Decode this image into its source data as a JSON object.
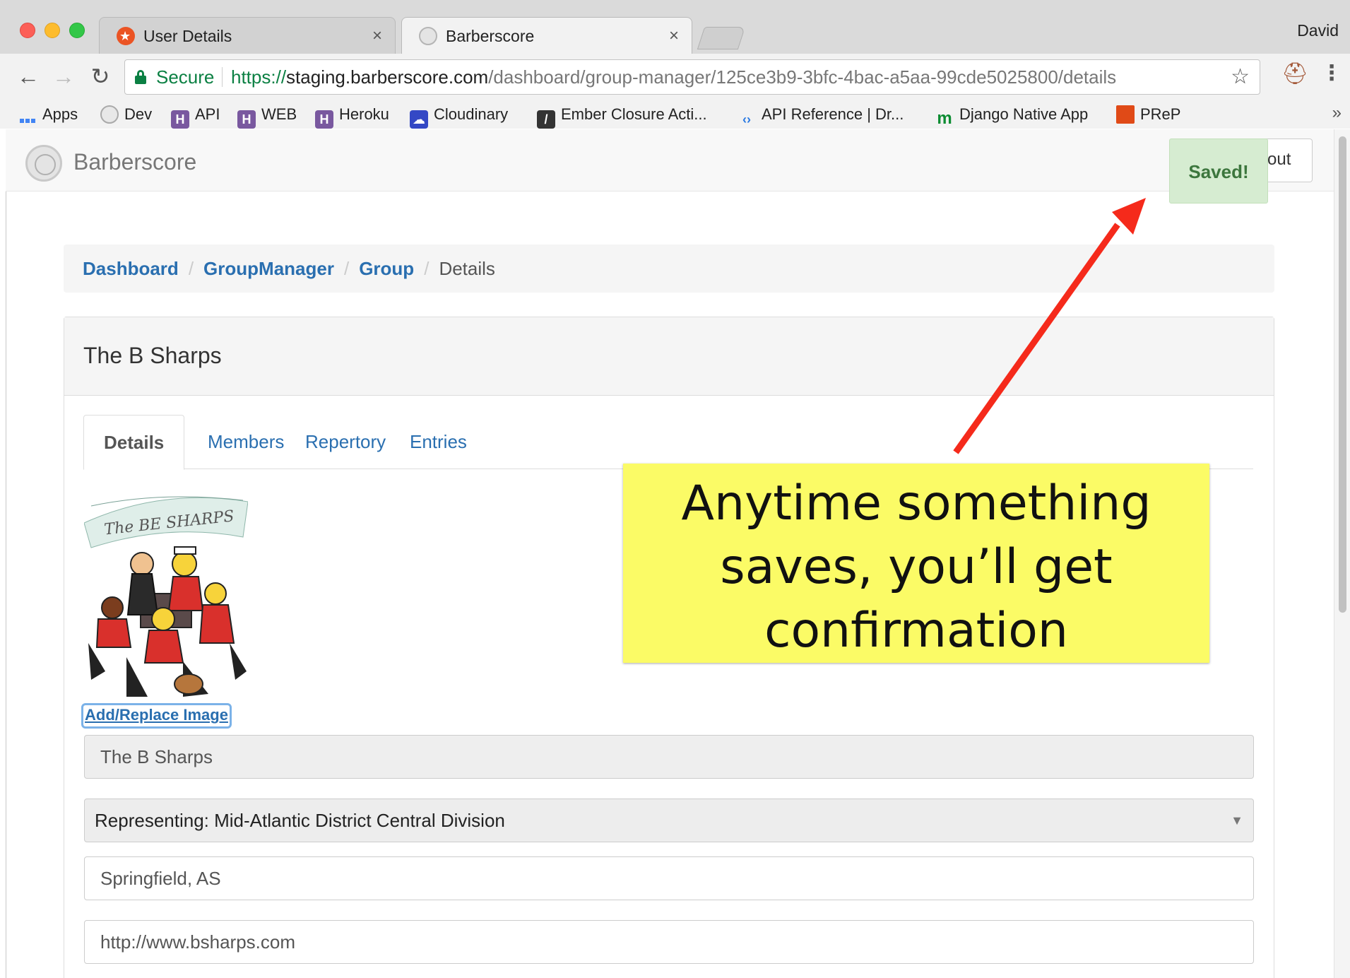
{
  "browser": {
    "tabs": [
      {
        "title": "User Details",
        "favicon": "auth0-icon"
      },
      {
        "title": "Barberscore",
        "favicon": "barberscore-icon"
      }
    ],
    "profile": "David",
    "secure_label": "Secure",
    "url": {
      "scheme": "https://",
      "host": "staging.barberscore.com",
      "path": "/dashboard/group-manager/125ce3b9-3bfc-4bac-a5aa-99cde5025800/details"
    },
    "bookmarks": [
      "Apps",
      "Dev",
      "API",
      "WEB",
      "Heroku",
      "Cloudinary",
      "Ember Closure Acti...",
      "API Reference  |  Dr...",
      "Django Native App",
      "PReP"
    ],
    "bookmarks_overflow": "»"
  },
  "app": {
    "brand": "Barberscore",
    "logout_label": "out",
    "toast": "Saved!"
  },
  "breadcrumb": [
    {
      "label": "Dashboard"
    },
    {
      "label": "GroupManager"
    },
    {
      "label": "Group"
    },
    {
      "label": "Details"
    }
  ],
  "breadcrumb_separator": "/",
  "panel": {
    "title": "The B Sharps",
    "tabs": [
      "Details",
      "Members",
      "Repertory",
      "Entries"
    ],
    "active_tab": "Details",
    "image_caption": "The BE SHARPS",
    "add_image_label": "Add/Replace Image"
  },
  "form": {
    "name": "The B Sharps",
    "representing": "Representing: Mid-Atlantic District Central Division",
    "location": "Springfield, AS",
    "website": "http://www.bsharps.com"
  },
  "annotation": {
    "callout_lines": [
      "Anytime something",
      "saves, you’ll get",
      "confirmation"
    ],
    "arrow_color": "#f52a1b",
    "callout_color": "#fbfb66"
  }
}
